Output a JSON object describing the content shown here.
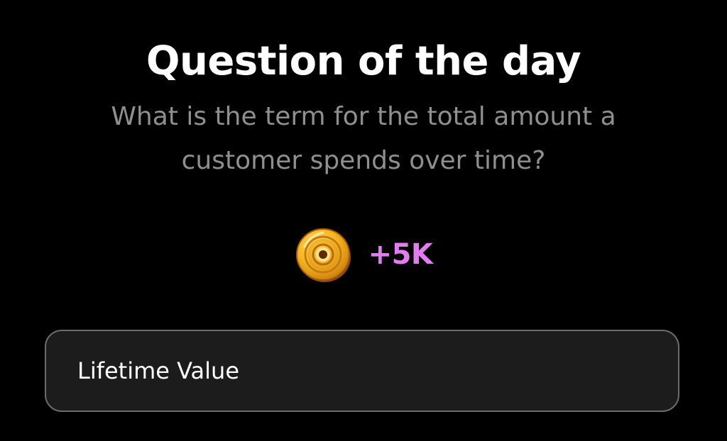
{
  "header": {
    "title": "Question of the day"
  },
  "question": {
    "text": "What is the term for the total amount a customer spends over time?"
  },
  "reward": {
    "icon": "coin-icon",
    "amount": "+5K",
    "amount_color": "#e27cf0"
  },
  "answer": {
    "value": "Lifetime Value"
  },
  "colors": {
    "background": "#000000",
    "title": "#ffffff",
    "question": "#8f8f8f",
    "answer_box_bg": "#1c1c1c",
    "answer_box_border": "#6b6b6b"
  }
}
